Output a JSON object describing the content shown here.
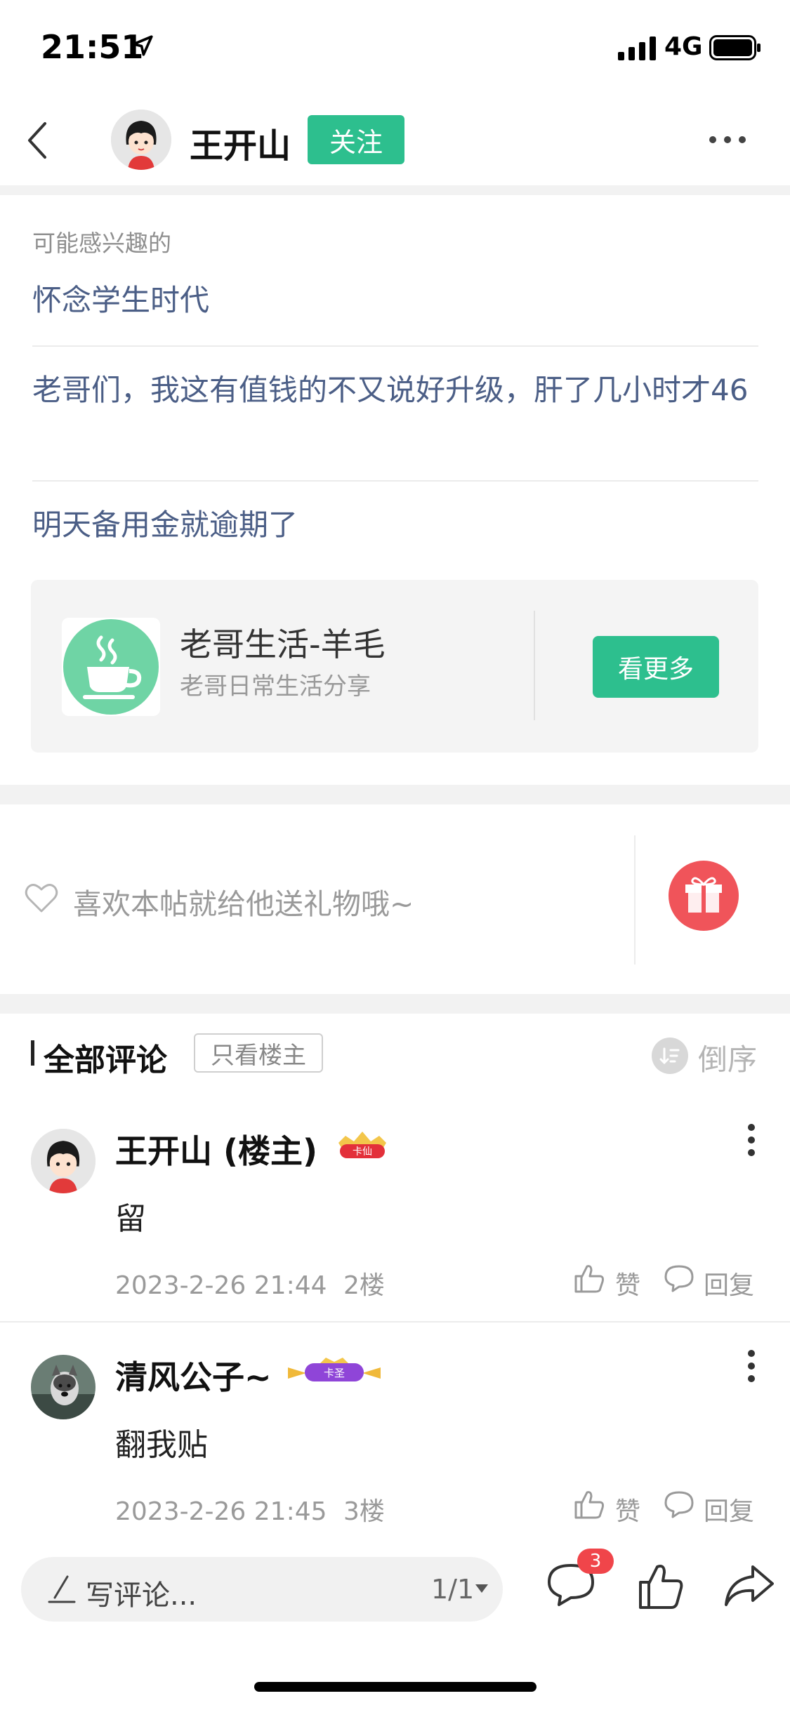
{
  "status_bar": {
    "time": "21:51",
    "network": "4G"
  },
  "header": {
    "author": "王开山",
    "follow_label": "关注"
  },
  "recommendations": {
    "heading": "可能感兴趣的",
    "items": [
      "怀念学生时代",
      "老哥们，我这有值钱的不又说好升级，肝了几小时才46",
      "明天备用金就逾期了"
    ]
  },
  "forum": {
    "name": "老哥生活-羊毛",
    "description": "老哥日常生活分享",
    "button_label": "看更多"
  },
  "gift": {
    "prompt": "喜欢本帖就给他送礼物哦~"
  },
  "comments_section": {
    "title": "全部评论",
    "op_only_label": "只看楼主",
    "sort_label": "倒序"
  },
  "comments": [
    {
      "author": "王开山 (楼主)",
      "badge_text": "卡仙",
      "text": "留",
      "time": "2023-2-26 21:44",
      "floor": "2楼",
      "like_label": "赞",
      "reply_label": "回复"
    },
    {
      "author": "清风公子~",
      "badge_text": "卡圣",
      "text": "翻我贴",
      "time": "2023-2-26 21:45",
      "floor": "3楼",
      "like_label": "赞",
      "reply_label": "回复"
    }
  ],
  "bottom_bar": {
    "placeholder": "写评论...",
    "page_indicator": "1/1",
    "comment_count": "3"
  },
  "colors": {
    "accent": "#2dbf8e",
    "link": "#4b5e86",
    "gift": "#f0545a",
    "badge": "#f0454a"
  }
}
